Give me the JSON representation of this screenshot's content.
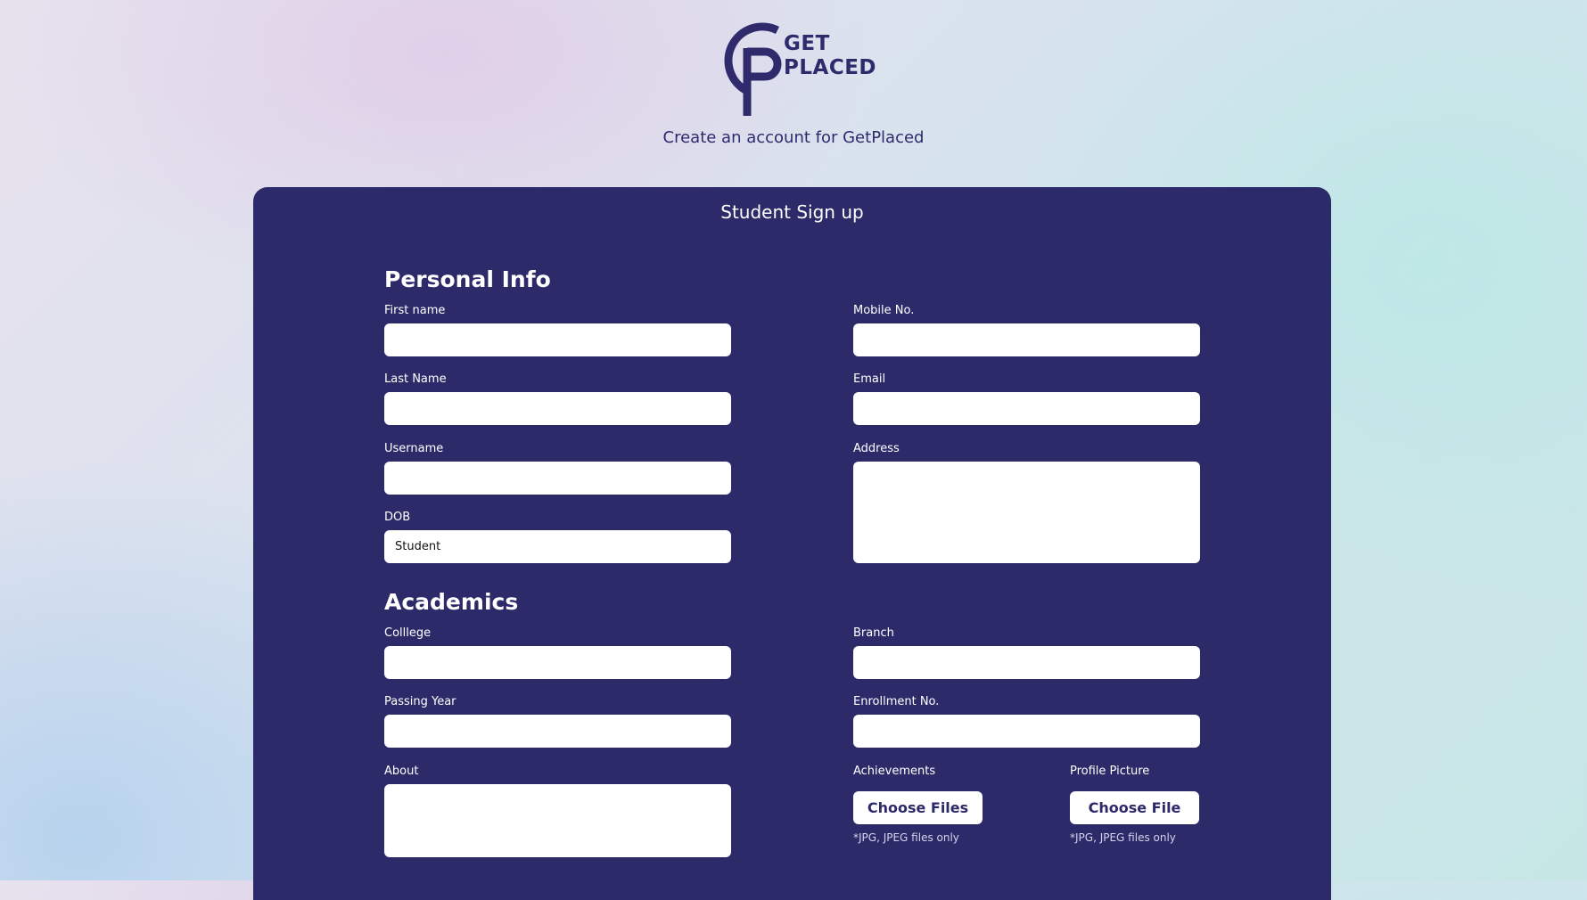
{
  "header": {
    "logo_line1": "GET",
    "logo_line2": "PLACED",
    "subtitle": "Create an account for GetPlaced"
  },
  "colors": {
    "brand": "#2d2a6a",
    "text_dark": "#2e2a6c",
    "input_bg": "#ffffff"
  },
  "form": {
    "title": "Student Sign up",
    "sections": {
      "personal": "Personal Info",
      "academics": "Academics"
    },
    "fields": {
      "first_name": {
        "label": "First name",
        "value": ""
      },
      "last_name": {
        "label": "Last Name",
        "value": ""
      },
      "username": {
        "label": "Username",
        "value": ""
      },
      "dob": {
        "label": "DOB",
        "value": "Student"
      },
      "mobile": {
        "label": "Mobile No.",
        "value": ""
      },
      "email": {
        "label": "Email",
        "value": ""
      },
      "address": {
        "label": "Address",
        "value": ""
      },
      "college": {
        "label": "Colllege",
        "value": ""
      },
      "passing_year": {
        "label": "Passing Year",
        "value": ""
      },
      "about": {
        "label": "About",
        "value": ""
      },
      "branch": {
        "label": "Branch",
        "value": ""
      },
      "enrollment": {
        "label": "Enrollment No.",
        "value": ""
      }
    },
    "uploads": {
      "achievements": {
        "label": "Achievements",
        "button": "Choose Files",
        "hint": "*JPG, JPEG files only"
      },
      "profile_picture": {
        "label": "Profile Picture",
        "button": "Choose File",
        "hint": "*JPG, JPEG files only"
      }
    }
  }
}
